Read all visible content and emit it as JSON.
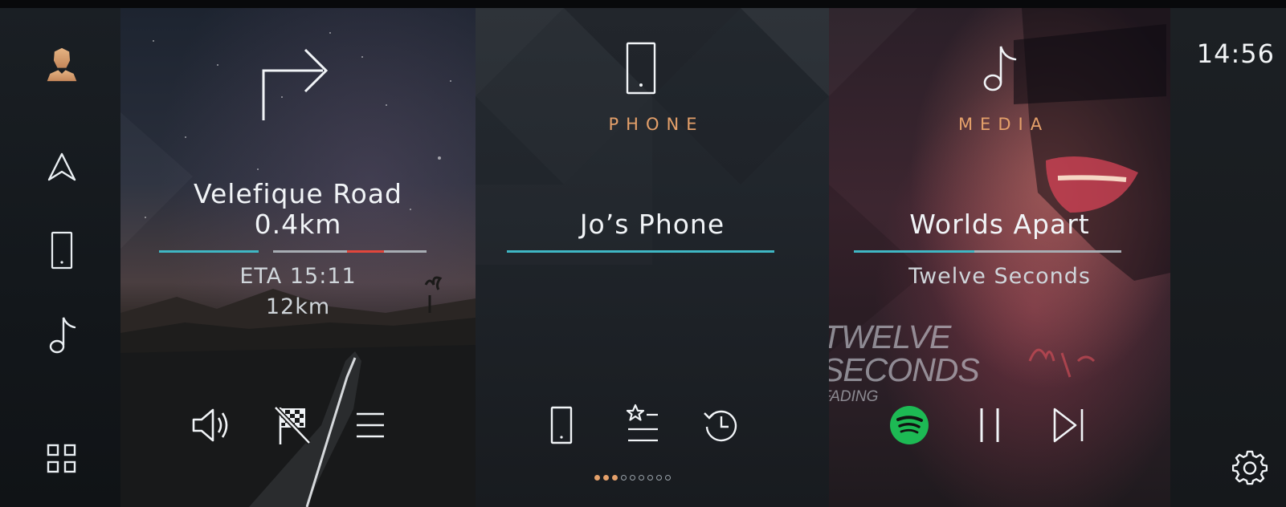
{
  "status": {
    "time": "14:56"
  },
  "sidebar": {
    "items": [
      {
        "icon": "profile-icon"
      },
      {
        "icon": "navigation-arrow-icon"
      },
      {
        "icon": "phone-icon"
      },
      {
        "icon": "music-note-icon"
      },
      {
        "icon": "apps-grid-icon"
      }
    ]
  },
  "navigation": {
    "street": "Velefique Road",
    "distance_to_turn": "0.4km",
    "eta": "ETA 15:11",
    "remaining": "12km",
    "controls": [
      "volume-icon",
      "destination-flag-off-icon",
      "menu-icon"
    ]
  },
  "phone": {
    "label": "PHONE",
    "device": "Jo’s Phone",
    "controls": [
      "phone-icon",
      "favorites-list-icon",
      "recent-calls-icon"
    ]
  },
  "media": {
    "label": "MEDIA",
    "track": "Worlds Apart",
    "artist": "Twelve Seconds",
    "album_art_text": [
      "TWELVE",
      "SECONDS",
      "FADING"
    ],
    "progress": 0.45,
    "controls": [
      "spotify-icon",
      "pause-icon",
      "skip-next-icon"
    ]
  },
  "pager": {
    "total": 9,
    "active": [
      0,
      1,
      2
    ]
  },
  "colors": {
    "accent_orange": "#e4a06a",
    "progress_teal": "#3fb7c4",
    "traffic_red": "#e2463c",
    "spotify_green": "#1db954"
  }
}
